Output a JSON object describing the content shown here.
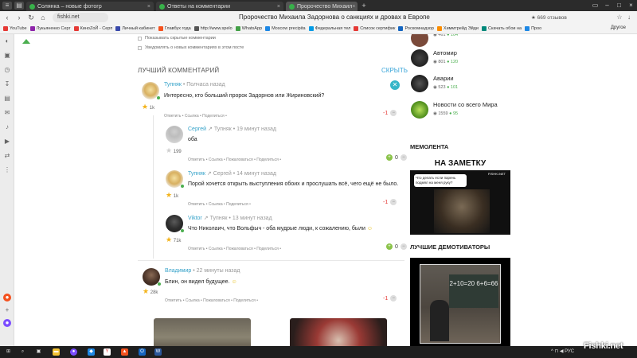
{
  "browser": {
    "tabs": [
      {
        "label": "Солянка – новые фотогр",
        "active": false
      },
      {
        "label": "Ответы на комментарии",
        "active": false
      },
      {
        "label": "Пророчество Михаил",
        "active": true
      }
    ],
    "url": "fishki.net",
    "page_title": "Пророчество Михаила Задорнова о санкциях и дровах в Европе",
    "reviews": "★ 669 отзывов",
    "bookmarks": [
      {
        "label": "YouTube",
        "color": "#e53935"
      },
      {
        "label": "Лукьяненко Серг",
        "color": "#8e24aa"
      },
      {
        "label": "КиноZоЙ - Серп",
        "color": "#e53935"
      },
      {
        "label": "Личный кабинет",
        "color": "#3949ab"
      },
      {
        "label": "Главбух года",
        "color": "#f4511e"
      },
      {
        "label": "http://www.spelo",
        "color": "#555555"
      },
      {
        "label": "WhatsApp",
        "color": "#43a047"
      },
      {
        "label": "Moscow precipita",
        "color": "#1e88e5"
      },
      {
        "label": "Федеральная тел",
        "color": "#039be5"
      },
      {
        "label": "Список сертифик",
        "color": "#e53935"
      },
      {
        "label": "Роскомнадзор",
        "color": "#1565c0"
      },
      {
        "label": "Химмтрейд Эйди",
        "color": "#fb8c00"
      },
      {
        "label": "Скачать обои на",
        "color": "#00897b"
      },
      {
        "label": "Проо",
        "color": "#1e88e5"
      }
    ],
    "other_bookmarks": "Другое"
  },
  "page": {
    "checkbox_show_hidden": "Показывать скрытые комментарии",
    "checkbox_notify": "Уведомлять о новых комментариях в этом посте",
    "best_comment_heading": "ЛУЧШИЙ КОММЕНТАРИЙ",
    "hide_link": "СКРЫТЬ",
    "action_links": "Ответить  •  Ссылка  •  Поделиться  •",
    "action_links_long": "Ответить  •  Ссылка  •  Пожаловаться  •  Поделиться  •",
    "comments": [
      {
        "author": "Тупняк",
        "time": "• Полчаса назад",
        "reply_to": "",
        "text": "Интересно, кто больший пророк Задорнов или Жириновский?",
        "rating": "1k",
        "votes": "-1"
      },
      {
        "author": "Сергей",
        "time": "• 19 минут назад",
        "reply_to": "Тупняк",
        "text": "оба",
        "rating": "199",
        "votes": "0"
      },
      {
        "author": "Тупняк",
        "time": "• 14 минут назад",
        "reply_to": "Сергей",
        "text": "Порой хочется открыть выступления обоих и прослушать всё, чего ещё не было.",
        "rating": "1k",
        "votes": "-1"
      },
      {
        "author": "Viktor",
        "time": "• 13 минут назад",
        "reply_to": "Тупняк",
        "text": "Что Николаич, что Вольфыч - оба мудрые люди, к сожалению, были",
        "rating": "71k",
        "votes": "0"
      },
      {
        "author": "Владимир",
        "time": "• 22 минуты назад",
        "reply_to": "",
        "text": "Блин, он видел будущее.",
        "rating": "28k",
        "votes": "-1"
      }
    ],
    "feed": [
      {
        "title": "",
        "views": "461",
        "score": "104"
      },
      {
        "title": "Автомир",
        "views": "801",
        "score": "120"
      },
      {
        "title": "Аварии",
        "views": "523",
        "score": "101"
      },
      {
        "title": "Новости со всего Мира",
        "views": "1559",
        "score": "95"
      }
    ],
    "memolenta_heading": "МЕМОЛЕНТА",
    "memo_top": "НА ЗАМЕТКУ",
    "memo_bubble": "Что делать если парень подмял на меня руку?",
    "memo_brand": "FISHKI.NET",
    "demot_heading": "ЛУЧШИЕ ДЕМОТИВАТОРЫ",
    "demot_board": "2+10=20 6+6=66"
  },
  "taskbar": {
    "tray": "^  ⊓  ◀ РУС",
    "watermark": "Fishki.net"
  }
}
